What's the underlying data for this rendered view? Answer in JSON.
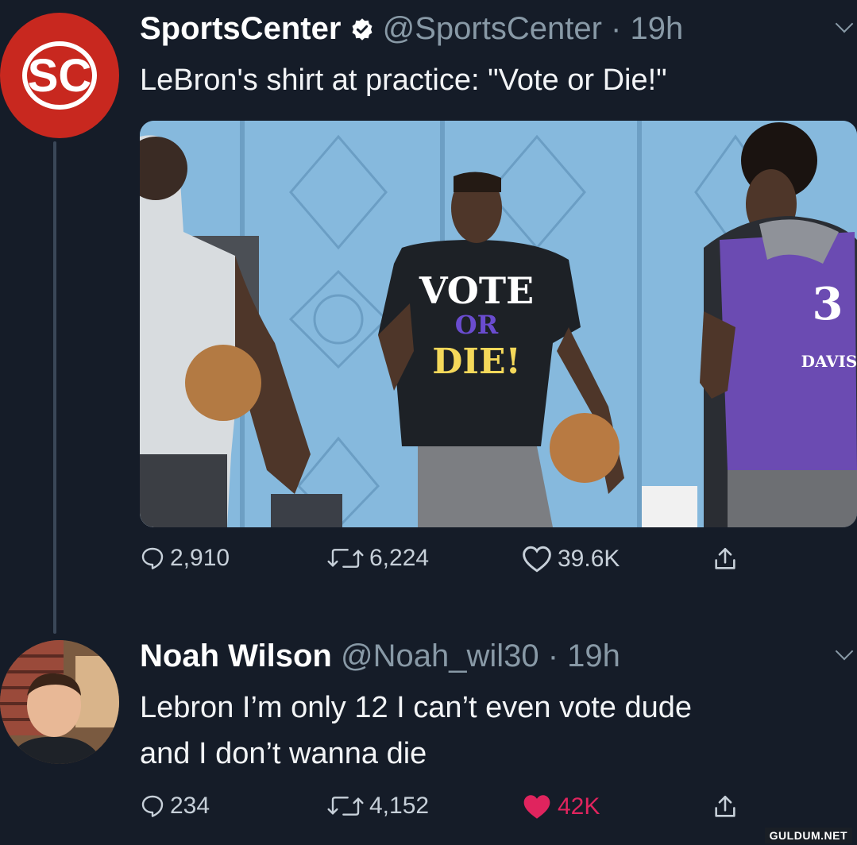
{
  "tweet": {
    "display_name": "SportsCenter",
    "handle": "@SportsCenter",
    "time": "19h",
    "text": "LeBron's shirt at practice: \"Vote or Die!\"",
    "avatar_text": "SC",
    "media_shirt": [
      "VOTE",
      "OR",
      "DIE!"
    ],
    "media_jersey": {
      "number": "3",
      "name": "DAVIS"
    },
    "stats": {
      "replies": "2,910",
      "retweets": "6,224",
      "likes": "39.6K"
    }
  },
  "reply": {
    "display_name": "Noah Wilson",
    "handle": "@Noah_wil30",
    "time": "19h",
    "text_line1": "Lebron I’m only 12 I can’t even vote dude",
    "text_line2": "and I don’t wanna die",
    "stats": {
      "replies": "234",
      "retweets": "4,152",
      "likes": "42K"
    }
  },
  "watermark": "GULDUM.NET",
  "colors": {
    "background": "#151c28",
    "brand_red": "#c8281f",
    "like_pink": "#e0245e",
    "muted": "#8899a6"
  },
  "icons": [
    "verified-badge-icon",
    "reply-icon",
    "retweet-icon",
    "heart-icon",
    "share-icon",
    "chevron-down-icon"
  ]
}
